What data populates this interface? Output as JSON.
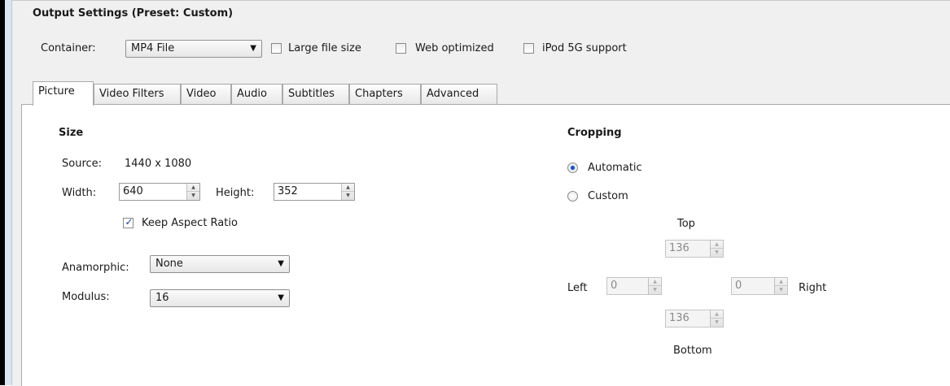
{
  "output_settings": {
    "title": "Output Settings (Preset: Custom)",
    "container_label": "Container:",
    "container_value": "MP4 File",
    "large_file_size_label": "Large file size",
    "web_optimized_label": "Web optimized",
    "ipod_label": "iPod 5G support",
    "large_file_size_checked": false,
    "web_optimized_checked": false,
    "ipod_checked": false
  },
  "tabs": [
    {
      "label": "Picture",
      "active": true
    },
    {
      "label": "Video Filters",
      "active": false
    },
    {
      "label": "Video",
      "active": false
    },
    {
      "label": "Audio",
      "active": false
    },
    {
      "label": "Subtitles",
      "active": false
    },
    {
      "label": "Chapters",
      "active": false
    },
    {
      "label": "Advanced",
      "active": false
    }
  ],
  "size": {
    "heading": "Size",
    "source_label": "Source:",
    "source_value": "1440 x 1080",
    "width_label": "Width:",
    "width_value": "640",
    "height_label": "Height:",
    "height_value": "352",
    "keep_aspect_label": "Keep Aspect Ratio",
    "keep_aspect_checked": true,
    "anamorphic_label": "Anamorphic:",
    "anamorphic_value": "None",
    "modulus_label": "Modulus:",
    "modulus_value": "16"
  },
  "cropping": {
    "heading": "Cropping",
    "automatic_label": "Automatic",
    "custom_label": "Custom",
    "selected": "Automatic",
    "top_label": "Top",
    "bottom_label": "Bottom",
    "left_label": "Left",
    "right_label": "Right",
    "top_value": "136",
    "bottom_value": "136",
    "left_value": "0",
    "right_value": "0"
  }
}
